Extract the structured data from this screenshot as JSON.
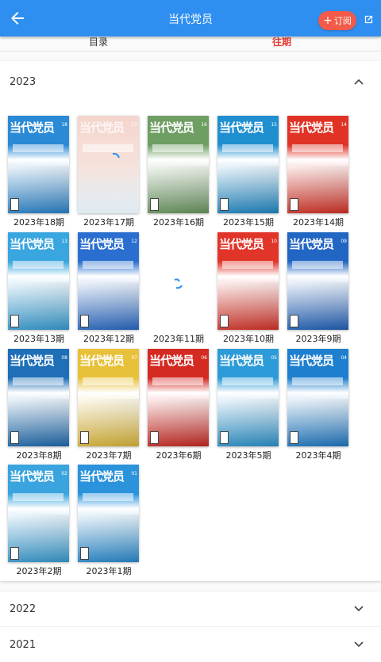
{
  "appbar": {
    "title": "当代党员",
    "subscribe_label": "订阅",
    "back_icon": "arrow-left-icon",
    "external_icon": "open-external-icon"
  },
  "tabs": [
    {
      "label": "目录",
      "active": false
    },
    {
      "label": "往期",
      "active": true
    }
  ],
  "years": [
    {
      "year": "2023",
      "expanded": true,
      "issues": [
        {
          "label": "2023年18期",
          "color": "#2a8ad6",
          "loaded": true,
          "num": "18"
        },
        {
          "label": "2023年17期",
          "color": "#f1c9c0",
          "loaded": "partial",
          "num": "17"
        },
        {
          "label": "2023年16期",
          "color": "#6f9e63",
          "loaded": true,
          "num": "16"
        },
        {
          "label": "2023年15期",
          "color": "#1f8fd0",
          "loaded": true,
          "num": "15"
        },
        {
          "label": "2023年14期",
          "color": "#e03326",
          "loaded": true,
          "num": "14"
        },
        {
          "label": "2023年13期",
          "color": "#39a6e0",
          "loaded": true,
          "num": "13"
        },
        {
          "label": "2023年12期",
          "color": "#2a6fd0",
          "loaded": true,
          "num": "12"
        },
        {
          "label": "2023年11期",
          "color": "#ffffff",
          "loaded": false,
          "num": "11"
        },
        {
          "label": "2023年10期",
          "color": "#e2352a",
          "loaded": true,
          "num": "10"
        },
        {
          "label": "2023年9期",
          "color": "#2266c4",
          "loaded": true,
          "num": "09"
        },
        {
          "label": "2023年8期",
          "color": "#1e6fb8",
          "loaded": true,
          "num": "08"
        },
        {
          "label": "2023年7期",
          "color": "#e8c13a",
          "loaded": true,
          "num": "07"
        },
        {
          "label": "2023年6期",
          "color": "#d42a22",
          "loaded": true,
          "num": "06"
        },
        {
          "label": "2023年5期",
          "color": "#2d9bd8",
          "loaded": true,
          "num": "05"
        },
        {
          "label": "2023年4期",
          "color": "#1f7fcf",
          "loaded": true,
          "num": "04"
        },
        {
          "label": "2023年2期",
          "color": "#3aa4de",
          "loaded": true,
          "num": "02"
        },
        {
          "label": "2023年1期",
          "color": "#2a93dc",
          "loaded": true,
          "num": "01"
        }
      ]
    },
    {
      "year": "2022",
      "expanded": false
    },
    {
      "year": "2021",
      "expanded": false
    }
  ],
  "masthead": "当代党员"
}
